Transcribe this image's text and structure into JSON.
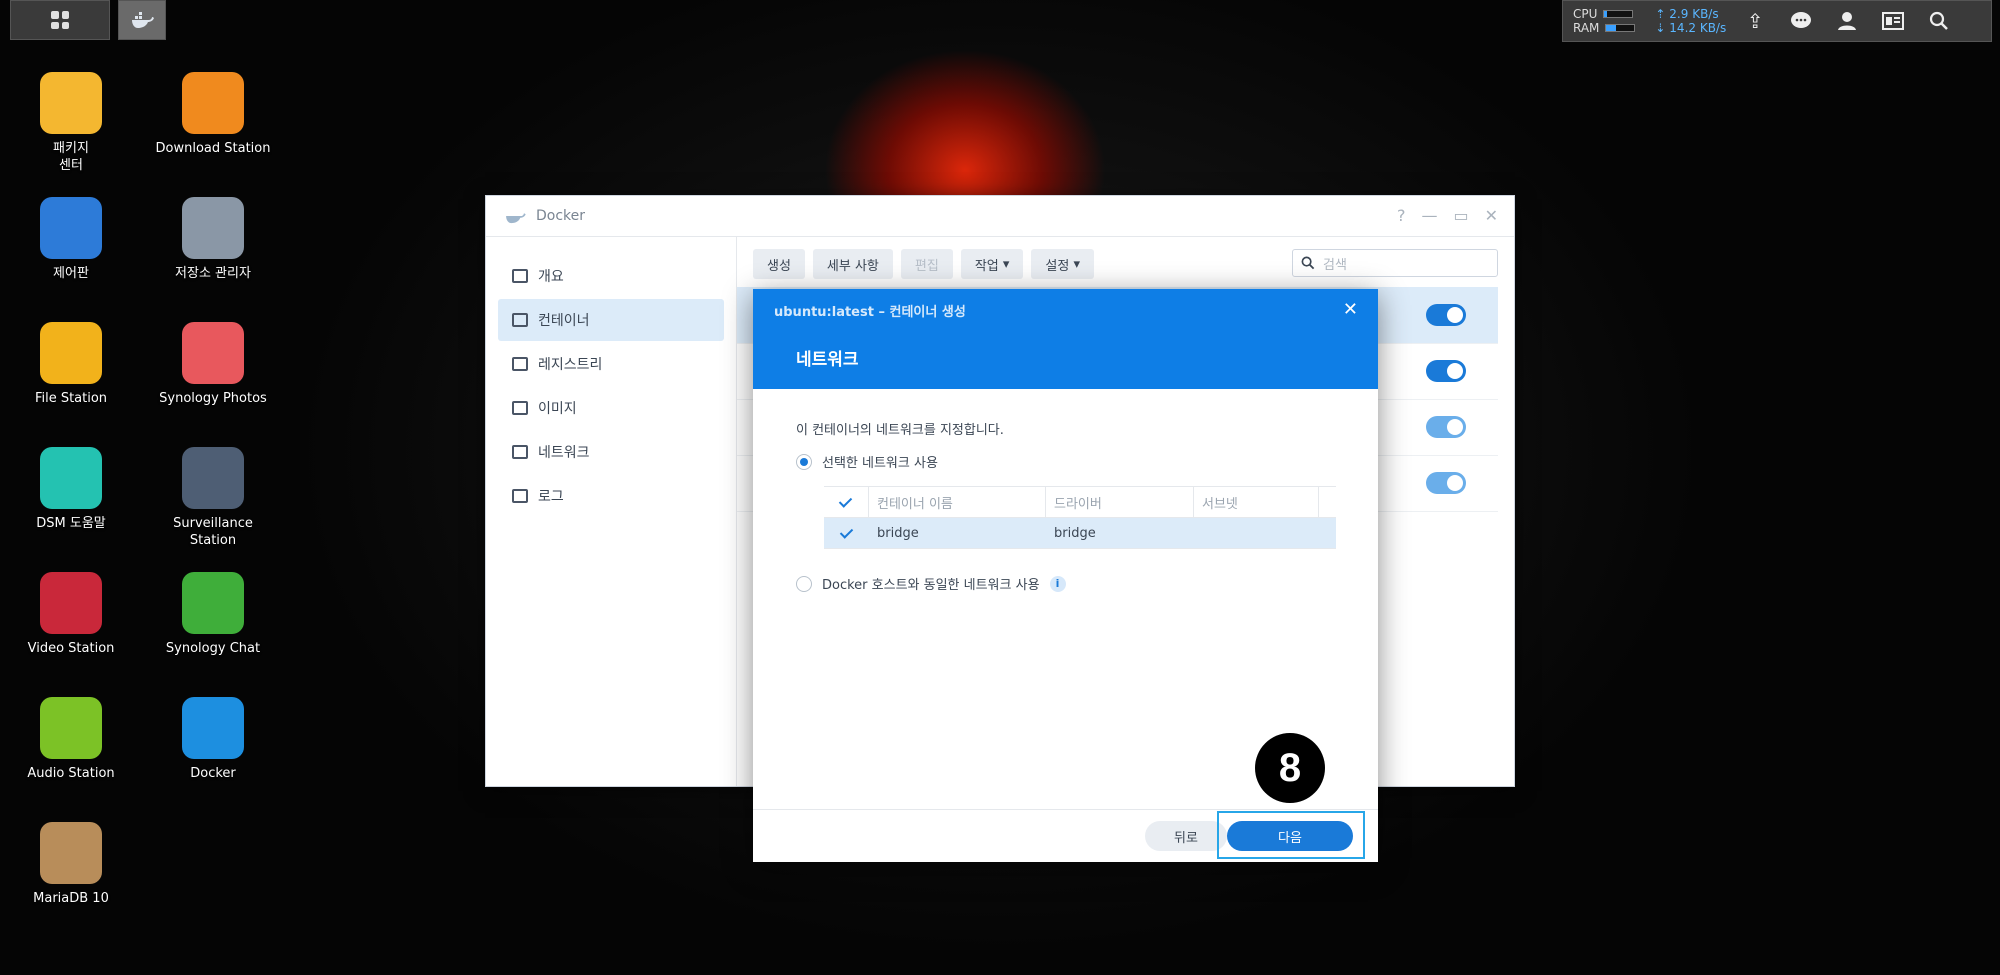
{
  "taskbar": {
    "cpu_label": "CPU",
    "ram_label": "RAM",
    "cpu_usage": 0.1,
    "ram_usage": 0.35,
    "upload": "2.9 KB/s",
    "download": "14.2 KB/s"
  },
  "desktop": [
    {
      "label": "패키지\n센터",
      "icon": "package-center-icon",
      "color": "#f4b730"
    },
    {
      "label": "Download Station",
      "icon": "download-station-icon",
      "color": "#f08a1e"
    },
    {
      "label": "제어판",
      "icon": "control-panel-icon",
      "color": "#2d7bd8"
    },
    {
      "label": "저장소 관리자",
      "icon": "storage-manager-icon",
      "color": "#8a97a6"
    },
    {
      "label": "File Station",
      "icon": "file-station-icon",
      "color": "#f2b21b"
    },
    {
      "label": "Synology Photos",
      "icon": "synology-photos-icon",
      "color": "#e8585d"
    },
    {
      "label": "DSM 도움말",
      "icon": "dsm-help-icon",
      "color": "#24c2b1"
    },
    {
      "label": "Surveillance Station",
      "icon": "surveillance-station-icon",
      "color": "#4e5e74"
    },
    {
      "label": "Video Station",
      "icon": "video-station-icon",
      "color": "#c9283a"
    },
    {
      "label": "Synology Chat",
      "icon": "synology-chat-icon",
      "color": "#3fae3a"
    },
    {
      "label": "Audio Station",
      "icon": "audio-station-icon",
      "color": "#7cc226"
    },
    {
      "label": "Docker",
      "icon": "docker-icon",
      "color": "#1d8fe0"
    },
    {
      "label": "MariaDB 10",
      "icon": "mariadb-icon",
      "color": "#b88d5a"
    }
  ],
  "docker_window": {
    "title": "Docker",
    "sidebar": [
      {
        "label": "개요"
      },
      {
        "label": "컨테이너"
      },
      {
        "label": "레지스트리"
      },
      {
        "label": "이미지"
      },
      {
        "label": "네트워크"
      },
      {
        "label": "로그"
      }
    ],
    "toolbar": {
      "create": "생성",
      "details": "세부 사항",
      "edit": "편집",
      "action": "작업",
      "settings": "설정"
    },
    "search_placeholder": "검색"
  },
  "modal": {
    "subtitle": "ubuntu:latest – 컨테이너 생성",
    "title": "네트워크",
    "description": "이 컨테이너의 네트워크를 지정합니다.",
    "option_selected": "선택한 네트워크 사용",
    "option_host": "Docker 호스트와 동일한 네트워크 사용",
    "table": {
      "headers": [
        "컨테이너 이름",
        "드라이버",
        "서브넷"
      ],
      "rows": [
        [
          "bridge",
          "bridge",
          ""
        ]
      ]
    },
    "back_button": "뒤로",
    "next_button": "다음"
  },
  "step_marker": "8",
  "colors": {
    "accent": "#1a7ad8",
    "header": "#0e7ee6",
    "highlight": "#27a6e8"
  }
}
